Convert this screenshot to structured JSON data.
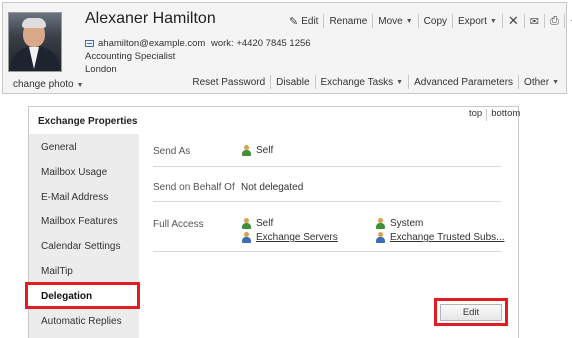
{
  "user": {
    "name": "Alexaner Hamilton",
    "email": "ahamilton@example.com",
    "title": "Accounting Specialist",
    "location": "London",
    "work_phone": "work: +4420 7845 1256",
    "change_photo_label": "change photo"
  },
  "toolbar_top": [
    {
      "label": "Edit",
      "icon": "edit-icon"
    },
    {
      "label": "Rename"
    },
    {
      "label": "Move",
      "dropdown": true
    },
    {
      "label": "Copy"
    },
    {
      "label": "Export",
      "dropdown": true
    }
  ],
  "toolbar_icons": [
    "close-icon",
    "mail-icon",
    "print-icon",
    "star-icon"
  ],
  "toolbar_bottom": [
    {
      "label": "Reset Password"
    },
    {
      "label": "Disable"
    },
    {
      "label": "Exchange Tasks",
      "dropdown": true
    },
    {
      "label": "Advanced Parameters"
    },
    {
      "label": "Other",
      "dropdown": true
    }
  ],
  "panel": {
    "title": "Exchange Properties",
    "top_label": "top",
    "bottom_label": "bottom"
  },
  "nav": {
    "items": [
      "General",
      "Mailbox Usage",
      "E-Mail Address",
      "Mailbox Features",
      "Calendar Settings",
      "MailTip",
      "Delegation",
      "Automatic Replies"
    ],
    "active": "Delegation"
  },
  "delegation": {
    "send_as_label": "Send As",
    "send_as_value": "Self",
    "send_on_behalf_label": "Send on Behalf Of",
    "send_on_behalf_value": "Not delegated",
    "full_access_label": "Full Access",
    "full_access": [
      {
        "name": "Self",
        "icon": "user-icon"
      },
      {
        "name": "System",
        "icon": "user-icon"
      },
      {
        "name": "Exchange Servers",
        "icon": "group-icon"
      },
      {
        "name": "Exchange Trusted Subs...",
        "icon": "group-icon"
      }
    ],
    "edit_label": "Edit"
  },
  "colors": {
    "highlight": "#e31b23",
    "sidebar_bg": "#ececec",
    "header_bg": "#f4f4f4"
  }
}
